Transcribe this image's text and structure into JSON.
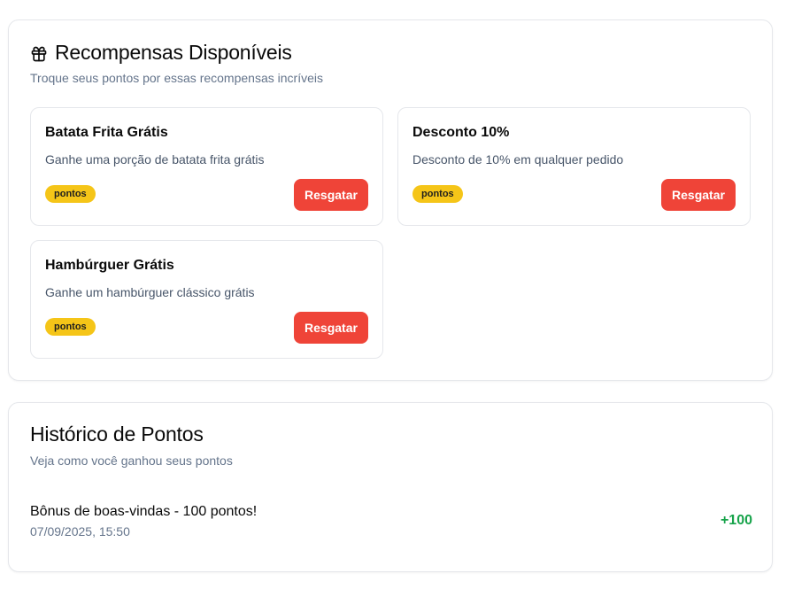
{
  "rewards": {
    "title": "Recompensas Disponíveis",
    "subtitle": "Troque seus pontos por essas recompensas incríveis",
    "icon": "gift-icon",
    "items": [
      {
        "name": "Batata Frita Grátis",
        "description": "Ganhe uma porção de batata frita grátis",
        "badge": "pontos",
        "button": "Resgatar"
      },
      {
        "name": "Desconto 10%",
        "description": "Desconto de 10% em qualquer pedido",
        "badge": "pontos",
        "button": "Resgatar"
      },
      {
        "name": "Hambúrguer Grátis",
        "description": "Ganhe um hambúrguer clássico grátis",
        "badge": "pontos",
        "button": "Resgatar"
      }
    ]
  },
  "history": {
    "title": "Histórico de Pontos",
    "subtitle": "Veja como você ganhou seus pontos",
    "entries": [
      {
        "description": "Bônus de boas-vindas - 100 pontos!",
        "date": "07/09/2025, 15:50",
        "points": "+100"
      }
    ]
  },
  "colors": {
    "accent_button": "#ef4438",
    "badge": "#f5c518",
    "positive_points": "#16a34a"
  }
}
